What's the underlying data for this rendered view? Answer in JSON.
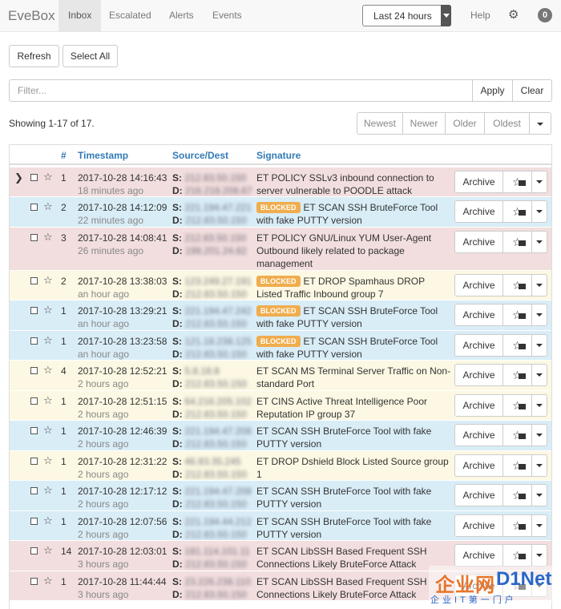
{
  "navbar": {
    "brand": "EveBox",
    "tabs": [
      "Inbox",
      "Escalated",
      "Alerts",
      "Events"
    ],
    "time_range": "Last 24 hours",
    "help": "Help",
    "badge": "0"
  },
  "toolbar": {
    "refresh": "Refresh",
    "select_all": "Select All"
  },
  "filter": {
    "placeholder": "Filter...",
    "apply": "Apply",
    "clear": "Clear"
  },
  "status": {
    "showing": "Showing 1-17 of 17."
  },
  "pager": {
    "newest": "Newest",
    "newer": "Newer",
    "older": "Older",
    "oldest": "Oldest"
  },
  "table": {
    "headers": {
      "count": "#",
      "timestamp": "Timestamp",
      "source_dest": "Source/Dest",
      "signature": "Signature"
    },
    "source_label": "S:",
    "dest_label": "D:",
    "archive_label": "Archive",
    "blocked_label": "BLOCKED",
    "rows": [
      {
        "count": "1",
        "timestamp": "2017-10-28 14:16:43",
        "ago": "18 minutes ago",
        "src": "212.83.50.150",
        "dst": "216.218.208.67",
        "blocked": false,
        "sig": "ET POLICY SSLv3 inbound connection to server vulnerable to POODLE attack",
        "status": "danger"
      },
      {
        "count": "2",
        "timestamp": "2017-10-28 14:12:09",
        "ago": "22 minutes ago",
        "src": "221.194.47.221",
        "dst": "212.83.50.150",
        "blocked": true,
        "sig": "ET SCAN SSH BruteForce Tool with fake PUTTY version",
        "status": "info"
      },
      {
        "count": "3",
        "timestamp": "2017-10-28 14:08:41",
        "ago": "26 minutes ago",
        "src": "212.83.50.150",
        "dst": "198.201.24.82",
        "blocked": false,
        "sig": "ET POLICY GNU/Linux YUM User-Agent Outbound likely related to package management",
        "status": "danger"
      },
      {
        "count": "2",
        "timestamp": "2017-10-28 13:38:03",
        "ago": "an hour ago",
        "src": "123.249.27.191",
        "dst": "212.83.50.150",
        "blocked": true,
        "sig": "ET DROP Spamhaus DROP Listed Traffic Inbound group 7",
        "status": "warning"
      },
      {
        "count": "1",
        "timestamp": "2017-10-28 13:29:21",
        "ago": "an hour ago",
        "src": "221.194.47.242",
        "dst": "212.83.50.150",
        "blocked": true,
        "sig": "ET SCAN SSH BruteForce Tool with fake PUTTY version",
        "status": "info"
      },
      {
        "count": "1",
        "timestamp": "2017-10-28 13:23:58",
        "ago": "an hour ago",
        "src": "121.18.238.125",
        "dst": "212.83.50.150",
        "blocked": true,
        "sig": "ET SCAN SSH BruteForce Tool with fake PUTTY version",
        "status": "info"
      },
      {
        "count": "4",
        "timestamp": "2017-10-28 12:52:21",
        "ago": "2 hours ago",
        "src": "5.8.18.8",
        "dst": "212.83.50.150",
        "blocked": false,
        "sig": "ET SCAN MS Terminal Server Traffic on Non-standard Port",
        "status": "warning"
      },
      {
        "count": "1",
        "timestamp": "2017-10-28 12:51:15",
        "ago": "2 hours ago",
        "src": "64.216.205.102",
        "dst": "212.83.50.150",
        "blocked": false,
        "sig": "ET CINS Active Threat Intelligence Poor Reputation IP group 37",
        "status": "warning"
      },
      {
        "count": "1",
        "timestamp": "2017-10-28 12:46:39",
        "ago": "2 hours ago",
        "src": "221.194.47.208",
        "dst": "212.83.50.150",
        "blocked": false,
        "sig": "ET SCAN SSH BruteForce Tool with fake PUTTY version",
        "status": "info"
      },
      {
        "count": "1",
        "timestamp": "2017-10-28 12:31:22",
        "ago": "2 hours ago",
        "src": "46.93.35.245",
        "dst": "212.83.50.150",
        "blocked": false,
        "sig": "ET DROP Dshield Block Listed Source group 1",
        "status": "warning"
      },
      {
        "count": "1",
        "timestamp": "2017-10-28 12:17:12",
        "ago": "2 hours ago",
        "src": "221.194.47.208",
        "dst": "212.83.50.150",
        "blocked": false,
        "sig": "ET SCAN SSH BruteForce Tool with fake PUTTY version",
        "status": "info"
      },
      {
        "count": "1",
        "timestamp": "2017-10-28 12:07:56",
        "ago": "2 hours ago",
        "src": "221.194.44.212",
        "dst": "212.83.50.150",
        "blocked": false,
        "sig": "ET SCAN SSH BruteForce Tool with fake PUTTY version",
        "status": "info"
      },
      {
        "count": "14",
        "timestamp": "2017-10-28 12:03:01",
        "ago": "3 hours ago",
        "src": "181.114.101.11",
        "dst": "212.83.50.150",
        "blocked": false,
        "sig": "ET SCAN LibSSH Based Frequent SSH Connections Likely BruteForce Attack",
        "status": "danger"
      },
      {
        "count": "1",
        "timestamp": "2017-10-28 11:44:44",
        "ago": "3 hours ago",
        "src": "23.226.238.110",
        "dst": "212.83.50.150",
        "blocked": false,
        "sig": "ET SCAN LibSSH Based Frequent SSH Connections Likely BruteForce Attack",
        "status": "danger"
      }
    ]
  },
  "watermark": {
    "main": "企业网",
    "net": "D1Net",
    "sub": "企业IT第一门户"
  }
}
